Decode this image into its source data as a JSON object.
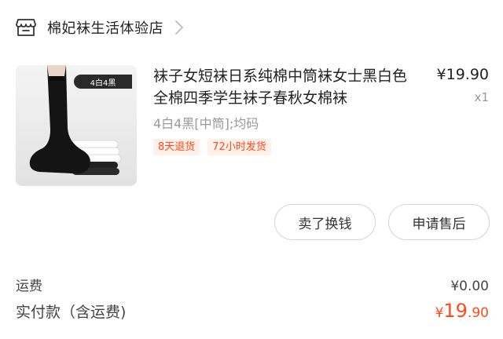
{
  "store": {
    "icon": "store-icon",
    "name": "棉妃袜生活体验店"
  },
  "product": {
    "image_tag": "4白4黑",
    "title": "袜子女短袜日系纯棉中筒袜女士黑白色全棉四季学生袜子春秋女棉袜",
    "price": "¥19.90",
    "quantity": "x1",
    "sku": "4白4黑[中筒];均码",
    "tags": [
      "8天退货",
      "72小时发货"
    ]
  },
  "actions": {
    "sell_label": "卖了换钱",
    "after_sale_label": "申请售后"
  },
  "summary": {
    "shipping_label": "运费",
    "shipping_value": "¥0.00",
    "total_label": "实付款（含运费)",
    "total_currency": "¥",
    "total_integer": "19",
    "total_decimal": ".90"
  },
  "colors": {
    "accent": "#ff4a1a",
    "tag_bg": "#fff0ea",
    "muted": "#999999"
  }
}
